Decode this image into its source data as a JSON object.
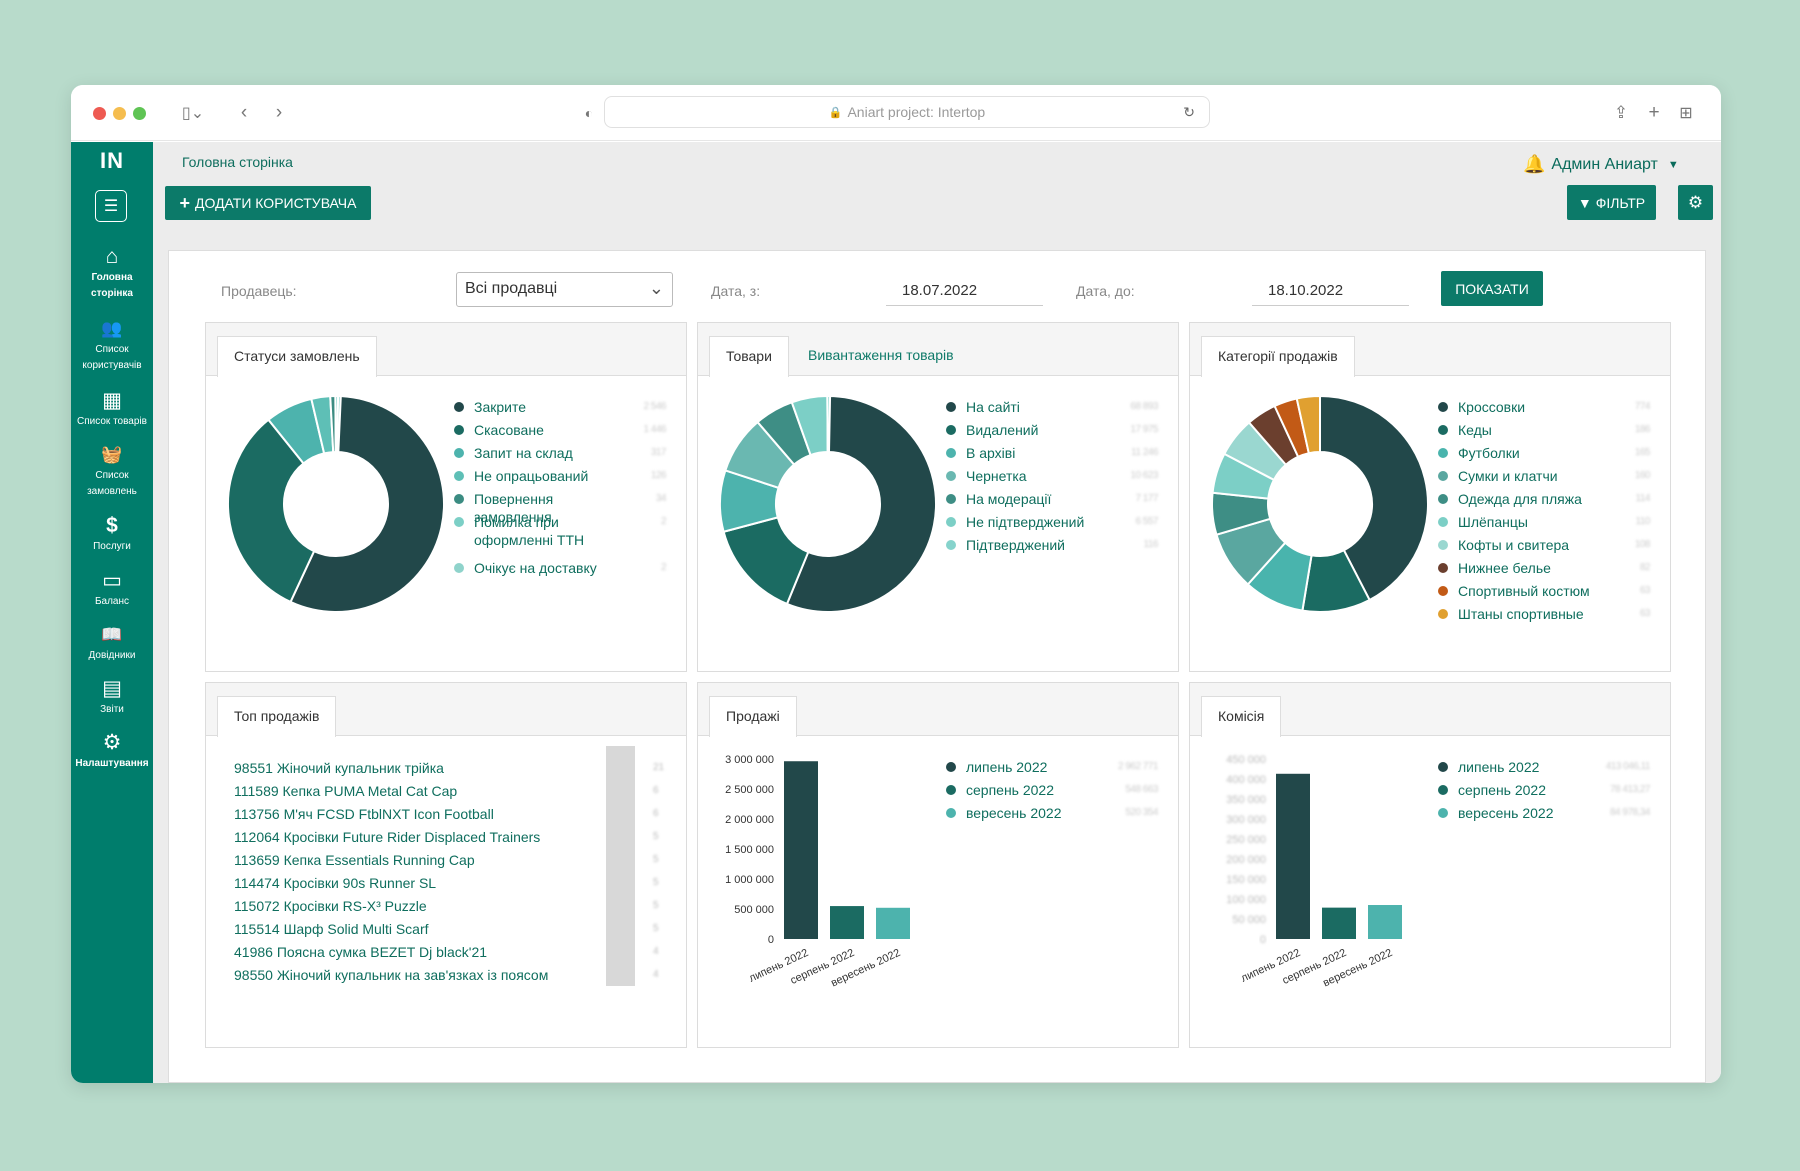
{
  "browser": {
    "address": "Aniart project: Intertop"
  },
  "colors": {
    "primary": "#0c7a69",
    "sidebar": "#007d6c",
    "link": "#0f6e5e"
  },
  "sidebar": {
    "logo": "IN",
    "items": [
      {
        "icon": "home-icon",
        "glyph": "⌂",
        "label": "Головна сторінка"
      },
      {
        "icon": "users-icon",
        "glyph": "👥",
        "label": "Список користувачів"
      },
      {
        "icon": "boxes-icon",
        "glyph": "▦",
        "label": "Список товарів"
      },
      {
        "icon": "basket-icon",
        "glyph": "🧺",
        "label": "Список замовлень"
      },
      {
        "icon": "dollar-hand-icon",
        "glyph": "$",
        "label": "Послуги"
      },
      {
        "icon": "wallet-icon",
        "glyph": "▭",
        "label": "Баланс"
      },
      {
        "icon": "book-icon",
        "glyph": "📖",
        "label": "Довідники"
      },
      {
        "icon": "table-icon",
        "glyph": "▤",
        "label": "Звіти"
      },
      {
        "icon": "gears-icon",
        "glyph": "⚙",
        "label": "Налаштування"
      }
    ]
  },
  "header": {
    "breadcrumb": "Головна сторінка",
    "add_user": "ДОДАТИ КОРИСТУВАЧА",
    "user": "Админ Аниарт",
    "filter": "ФІЛЬТР"
  },
  "filters": {
    "seller_label": "Продавець:",
    "seller_value": "Всі продавці",
    "date_from_label": "Дата, з:",
    "date_from": "18.07.2022",
    "date_to_label": "Дата, до:",
    "date_to": "18.10.2022",
    "show": "ПОКАЗАТИ"
  },
  "panels": {
    "statuses": {
      "tab": "Статуси замовлень"
    },
    "goods": {
      "tab": "Товари",
      "tab2": "Вивантаження товарів"
    },
    "categories": {
      "tab": "Категорії продажів"
    },
    "top": {
      "tab": "Топ продажів"
    },
    "sales": {
      "tab": "Продажі"
    },
    "commission": {
      "tab": "Комісія"
    }
  },
  "top_sales": [
    {
      "name": "98551 Жіночий купальник трійка",
      "qty": "21"
    },
    {
      "name": "111589 Кепка PUMA Metal Cat Cap",
      "qty": "6"
    },
    {
      "name": "113756 М'яч FCSD FtblNXT Icon Football",
      "qty": "6"
    },
    {
      "name": "112064 Кросівки Future Rider Displaced Trainers",
      "qty": "5"
    },
    {
      "name": "113659 Кепка Essentials Running Cap",
      "qty": "5"
    },
    {
      "name": "114474 Кросівки 90s Runner SL",
      "qty": "5"
    },
    {
      "name": "115072 Кросівки RS-X³ Puzzle",
      "qty": "5"
    },
    {
      "name": "115514 Шарф Solid Multi Scarf",
      "qty": "5"
    },
    {
      "name": "41986 Поясна сумка BEZET Dj black'21",
      "qty": "4"
    },
    {
      "name": "98550 Жіночий купальник на зав'язках із поясом",
      "qty": "4"
    }
  ],
  "chart_data": [
    {
      "type": "pie",
      "labels": [
        "Закрите",
        "Скасоване",
        "Запит на склад",
        "Не опрацьований",
        "Повернення замовлення",
        "Помилка при оформленні ТТН",
        "Очікує на доставку"
      ],
      "values": [
        2546,
        1446,
        317,
        126,
        34,
        2,
        2
      ],
      "value_labels": [
        "2 546",
        "1 446",
        "317",
        "126",
        "34",
        "2",
        "2"
      ],
      "colors": [
        "#22484a",
        "#1b6b62",
        "#4db3ad",
        "#5ebfb6",
        "#3b8c82",
        "#7ccfc6",
        "#8fd3cb"
      ]
    },
    {
      "type": "pie",
      "labels": [
        "На сайті",
        "Видалений",
        "В архіві",
        "Чернетка",
        "На модерації",
        "Не підтверджений",
        "Підтверджений"
      ],
      "values": [
        68893,
        17975,
        11246,
        10623,
        7177,
        6557,
        116
      ],
      "value_labels": [
        "68 893",
        "17 975",
        "11 246",
        "10 623",
        "7 177",
        "6 557",
        "116"
      ],
      "colors": [
        "#22484a",
        "#1b6b62",
        "#4db3ad",
        "#6ab8b1",
        "#3e8e85",
        "#7ccfc6",
        "#86d3cc"
      ]
    },
    {
      "type": "pie",
      "labels": [
        "Кроссовки",
        "Кеды",
        "Футболки",
        "Сумки и клатчи",
        "Одежда для пляжа",
        "Шлёпанцы",
        "Кофты и свитера",
        "Нижнее белье",
        "Спортивный костюм",
        "Штаны спортивные"
      ],
      "values": [
        774,
        186,
        165,
        160,
        114,
        110,
        108,
        82,
        63,
        63
      ],
      "value_labels": [
        "774",
        "186",
        "165",
        "160",
        "114",
        "110",
        "108",
        "82",
        "63",
        "63"
      ],
      "colors": [
        "#22484a",
        "#1b6b62",
        "#49b4ad",
        "#5aa7a0",
        "#3e8e85",
        "#7ccfc6",
        "#9ad7d0",
        "#6b3f2e",
        "#c25a16",
        "#e0a030"
      ]
    },
    {
      "type": "bar",
      "categories": [
        "липень 2022",
        "серпень 2022",
        "вересень 2022"
      ],
      "values": [
        2962771,
        548663,
        520354
      ],
      "value_labels": [
        "2 962 771",
        "548 663",
        "520 354"
      ],
      "colors": [
        "#22484a",
        "#1b6b62",
        "#4db3ad"
      ],
      "ylim": [
        0,
        3000000
      ],
      "yticks": [
        "0",
        "500 000",
        "1 000 000",
        "1 500 000",
        "2 000 000",
        "2 500 000",
        "3 000 000"
      ]
    },
    {
      "type": "bar",
      "categories": [
        "липень 2022",
        "серпень 2022",
        "вересень 2022"
      ],
      "values": [
        413046,
        78413,
        84978
      ],
      "value_labels": [
        "413 046,11",
        "78 413,27",
        "84 978,34"
      ],
      "colors": [
        "#22484a",
        "#1b6b62",
        "#4db3ad"
      ],
      "ylim": [
        0,
        450000
      ],
      "yticks": [
        "0",
        "50 000",
        "100 000",
        "150 000",
        "200 000",
        "250 000",
        "300 000",
        "350 000",
        "400 000",
        "450 000"
      ]
    }
  ]
}
